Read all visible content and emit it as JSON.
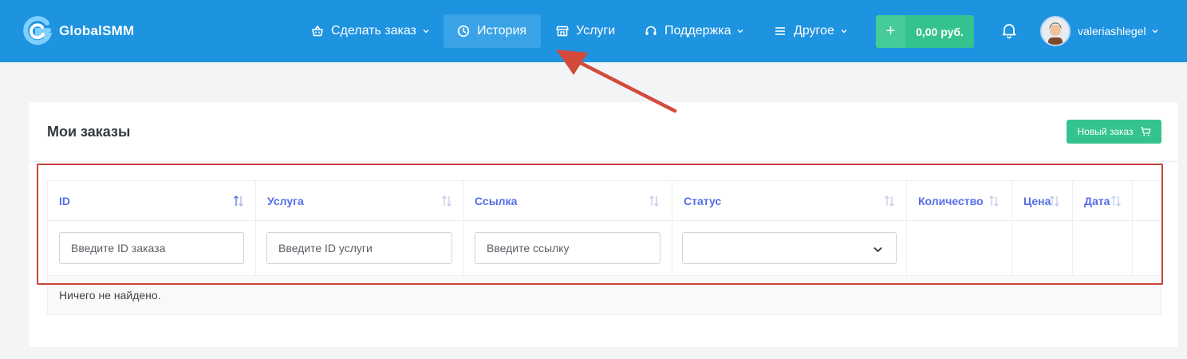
{
  "brand": {
    "name": "GlobalSMM"
  },
  "nav": {
    "make_order": "Сделать заказ",
    "history": "История",
    "services": "Услуги",
    "support": "Поддержка",
    "other": "Другое"
  },
  "balance": {
    "plus": "+",
    "amount": "0,00 руб."
  },
  "user": {
    "name": "valeriashlegel"
  },
  "page": {
    "title": "Мои заказы",
    "new_order_label": "Новый заказ"
  },
  "table": {
    "columns": [
      "ID",
      "Услуга",
      "Ссылка",
      "Статус",
      "Количество",
      "Цена",
      "Дата"
    ],
    "filters": {
      "id_placeholder": "Введите ID заказа",
      "service_placeholder": "Введите ID услуги",
      "link_placeholder": "Введите ссылку",
      "status_value": ""
    },
    "empty_message": "Ничего не найдено."
  },
  "colors": {
    "header": "#1e93e0",
    "accent_green": "#34c38f",
    "column_header": "#556ee6",
    "annotation_red": "#c8453b"
  },
  "icons": [
    "logo-icon",
    "basket-icon",
    "clock-icon",
    "store-icon",
    "headset-icon",
    "menu-icon",
    "chevron-down-icon",
    "bell-icon",
    "cart-icon",
    "sort-icon"
  ]
}
